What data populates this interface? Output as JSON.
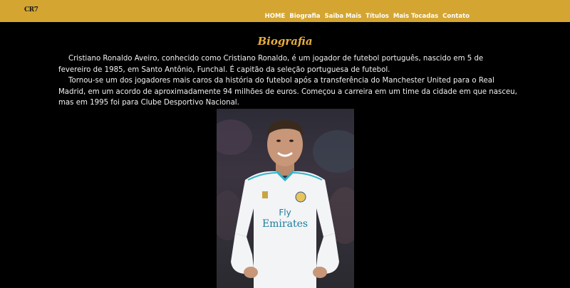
{
  "header": {
    "logo": "CR7",
    "nav": [
      "HOME",
      "Biografia",
      "Saiba Mais",
      "Títulos",
      "Mais Tocadas",
      "Contato"
    ]
  },
  "main": {
    "title": "Biografia",
    "paragraphs": [
      "Cristiano Ronaldo Aveiro, conhecido como Cristiano Ronaldo, é um jogador de futebol português, nascido em 5 de fevereiro de 1985, em Santo Antônio, Funchal. É capitão da seleção portuguesa de futebol.",
      "Tornou-se um dos jogadores mais caros da história do futebol após a transferência do Manchester United para o Real Madrid, em um acordo de aproximadamente 94 milhões de euros. Começou a carreira em um time da cidade em que nasceu, mas em 1995 foi para Clube Desportivo Nacional."
    ],
    "photo": {
      "shirt_text_line1": "Fly",
      "shirt_text_line2": "Emirates"
    }
  },
  "colors": {
    "navbar": "#d4a531",
    "title": "#e6ad3b",
    "background": "#000000"
  }
}
